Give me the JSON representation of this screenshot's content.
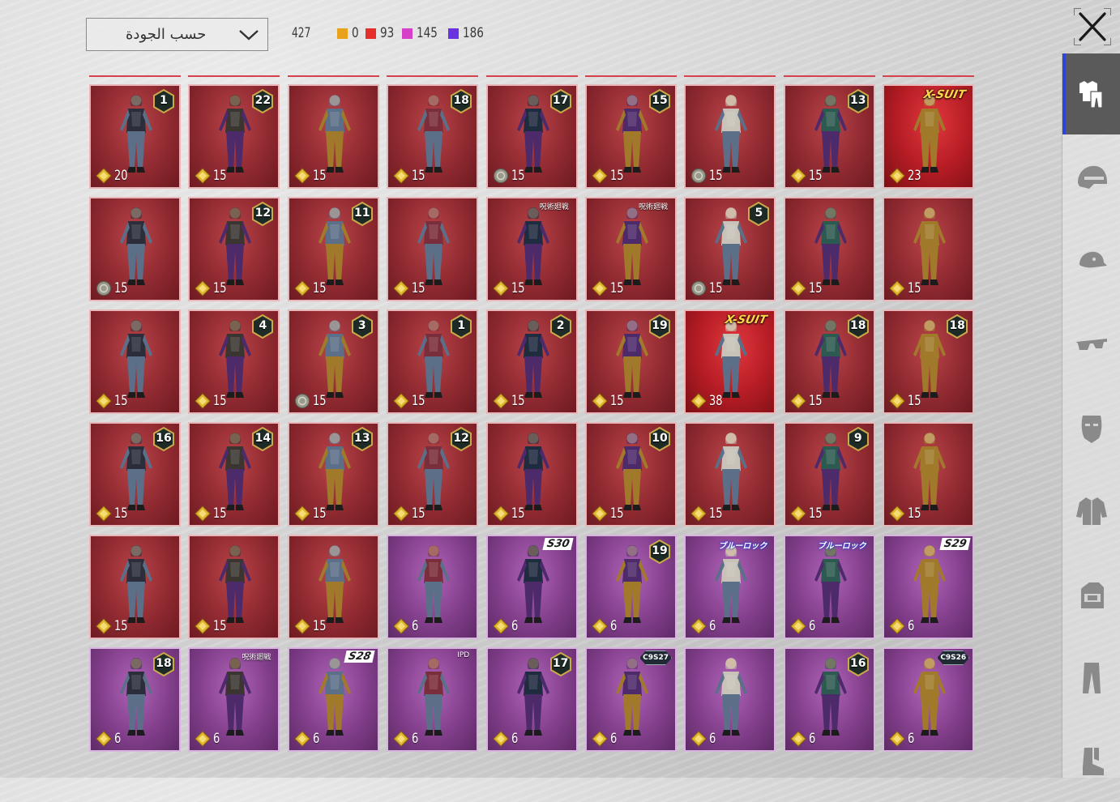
{
  "toolbar": {
    "sort_label": "حسب الجودة",
    "total_count": "427",
    "quality_counts": [
      {
        "color": "#e8a21c",
        "value": "0"
      },
      {
        "color": "#e42f2a",
        "value": "93"
      },
      {
        "color": "#d63fc7",
        "value": "145"
      },
      {
        "color": "#6a33e0",
        "value": "186"
      }
    ]
  },
  "icons": {
    "close": "close-icon",
    "sidebar": [
      "outfit-icon",
      "helmet-icon",
      "cap-icon",
      "glasses-icon",
      "mask-icon",
      "jacket-icon",
      "backpack-icon",
      "pants-icon",
      "boots-icon"
    ]
  },
  "colors": {
    "mythic_red": "#902a31",
    "legendary_purple": "#833f8c",
    "sidebar_active": "#5a5a5a",
    "sidebar_accent": "#2c44d8"
  },
  "items": [
    {
      "price": "20",
      "badge": "1",
      "rarity": "red"
    },
    {
      "price": "15",
      "badge": "22",
      "rarity": "red"
    },
    {
      "price": "15",
      "rarity": "red"
    },
    {
      "price": "15",
      "badge": "18",
      "rarity": "red"
    },
    {
      "price": "15",
      "badge": "17",
      "rarity": "red",
      "coin": "silver"
    },
    {
      "price": "15",
      "badge": "15",
      "rarity": "red"
    },
    {
      "price": "15",
      "rarity": "red",
      "coin": "silver"
    },
    {
      "price": "15",
      "badge": "13",
      "rarity": "red"
    },
    {
      "price": "23",
      "tag": "X-SUIT",
      "tag_style": "gold",
      "rarity": "xsuit"
    },
    {
      "price": "15",
      "rarity": "red",
      "coin": "silver"
    },
    {
      "price": "15",
      "badge": "12",
      "rarity": "red"
    },
    {
      "price": "15",
      "badge": "11",
      "rarity": "red"
    },
    {
      "price": "15",
      "rarity": "red"
    },
    {
      "price": "15",
      "rarity": "red",
      "tag": "呪術廻戦",
      "tag_style": "plain"
    },
    {
      "price": "15",
      "rarity": "red",
      "tag": "呪術廻戦",
      "tag_style": "plain"
    },
    {
      "price": "15",
      "badge": "5",
      "rarity": "red",
      "coin": "silver"
    },
    {
      "price": "15",
      "rarity": "red"
    },
    {
      "price": "15",
      "rarity": "red"
    },
    {
      "price": "15",
      "rarity": "red"
    },
    {
      "price": "15",
      "badge": "4",
      "rarity": "red"
    },
    {
      "price": "15",
      "badge": "3",
      "rarity": "red",
      "coin": "silver"
    },
    {
      "price": "15",
      "badge": "1",
      "rarity": "red"
    },
    {
      "price": "15",
      "badge": "2",
      "rarity": "red"
    },
    {
      "price": "15",
      "badge": "19",
      "rarity": "red"
    },
    {
      "price": "38",
      "tag": "X-SUIT",
      "tag_style": "gold",
      "rarity": "xsuit"
    },
    {
      "price": "15",
      "badge": "18",
      "rarity": "red"
    },
    {
      "price": "15",
      "badge": "18",
      "rarity": "red"
    },
    {
      "price": "15",
      "badge": "16",
      "rarity": "red"
    },
    {
      "price": "15",
      "badge": "14",
      "rarity": "red"
    },
    {
      "price": "15",
      "badge": "13",
      "rarity": "red"
    },
    {
      "price": "15",
      "badge": "12",
      "rarity": "red"
    },
    {
      "price": "15",
      "rarity": "red"
    },
    {
      "price": "15",
      "badge": "10",
      "rarity": "red"
    },
    {
      "price": "15",
      "rarity": "red"
    },
    {
      "price": "15",
      "badge": "9",
      "rarity": "red"
    },
    {
      "price": "15",
      "rarity": "red"
    },
    {
      "price": "15",
      "rarity": "red"
    },
    {
      "price": "15",
      "rarity": "red"
    },
    {
      "price": "15",
      "rarity": "red"
    },
    {
      "price": "6",
      "rarity": "purple"
    },
    {
      "price": "6",
      "rarity": "purple",
      "tag": "S30",
      "tag_style": "season"
    },
    {
      "price": "6",
      "badge": "19",
      "rarity": "purple"
    },
    {
      "price": "6",
      "rarity": "purple",
      "tag": "ブルーロック",
      "tag_style": "blue"
    },
    {
      "price": "6",
      "rarity": "purple",
      "tag": "ブルーロック",
      "tag_style": "blue"
    },
    {
      "price": "6",
      "rarity": "purple",
      "tag": "S29",
      "tag_style": "season"
    },
    {
      "price": "6",
      "badge": "18",
      "rarity": "purple"
    },
    {
      "price": "6",
      "rarity": "purple",
      "tag": "呪術廻戦",
      "tag_style": "plain"
    },
    {
      "price": "6",
      "rarity": "purple",
      "tag": "S28",
      "tag_style": "season"
    },
    {
      "price": "6",
      "rarity": "purple",
      "tag": "IPD",
      "tag_style": "plain"
    },
    {
      "price": "6",
      "badge": "17",
      "rarity": "purple"
    },
    {
      "price": "6",
      "rarity": "purple",
      "tag": "C9S27",
      "tag_style": "cs"
    },
    {
      "price": "6",
      "rarity": "purple"
    },
    {
      "price": "6",
      "badge": "16",
      "rarity": "purple"
    },
    {
      "price": "6",
      "rarity": "purple",
      "tag": "C9S26",
      "tag_style": "cs"
    }
  ]
}
